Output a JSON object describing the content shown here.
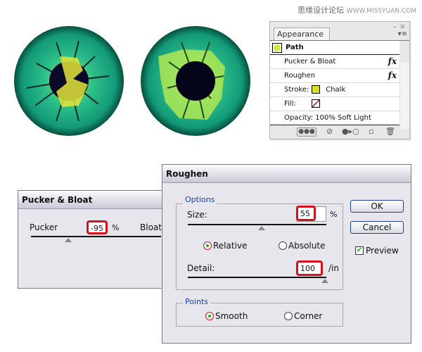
{
  "watermark": {
    "cn": "思缘设计论坛",
    "url": "WWW.MISSYUAN.COM"
  },
  "appearance": {
    "tab": "Appearance",
    "close": "×",
    "minimize": "–",
    "panel_close": "×",
    "menu": "▾≡",
    "path_label": "Path",
    "path_color": "#d8e63a",
    "effects": [
      {
        "label": "Pucker & Bloat",
        "fx": "fx"
      },
      {
        "label": "Roughen",
        "fx": "fx"
      }
    ],
    "stroke_label": "Stroke:",
    "stroke_value": "Chalk",
    "stroke_color": "#d8e020",
    "fill_label": "Fill:",
    "opacity": "Opacity: 100% Soft Light"
  },
  "pucker": {
    "title": "Pucker & Bloat",
    "left_label": "Pucker",
    "value": "-95",
    "unit": "%",
    "right_label": "Bloat",
    "slider_value": -95
  },
  "roughen": {
    "title": "Roughen",
    "options_legend": "Options",
    "size_label": "Size:",
    "size_value": "55",
    "size_unit": "%",
    "relative": "Relative",
    "absolute": "Absolute",
    "mode_selected": "Relative",
    "detail_label": "Detail:",
    "detail_value": "100",
    "detail_unit": "/in",
    "points_legend": "Points",
    "smooth": "Smooth",
    "corner": "Corner",
    "points_selected": "Smooth",
    "ok": "OK",
    "cancel": "Cancel",
    "preview": "Preview",
    "preview_checked": true
  },
  "colors": {
    "highlight": "#d4121e",
    "legend": "#1a3fa8",
    "iris": "#1aa37a",
    "pupil": "#05051a"
  }
}
